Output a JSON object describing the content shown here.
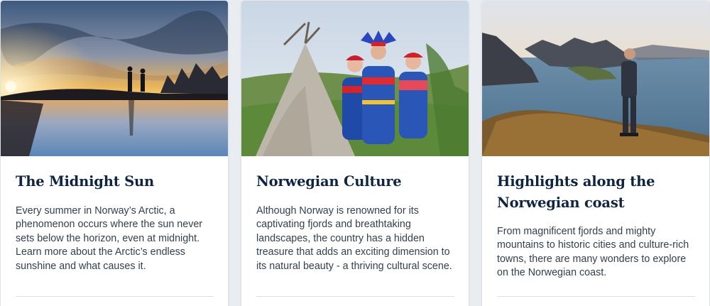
{
  "cards": [
    {
      "title": "The Midnight Sun",
      "body": "Every summer in Norway’s Arctic, a phenomenon occurs where the sun never sets below the horizon, even at midnight. Learn more about the Arctic’s endless sunshine and what causes it.",
      "image": "midnight-sun-photo"
    },
    {
      "title": "Norwegian Culture",
      "body": "Although Norway is renowned for its captivating fjords and breathtaking landscapes, the country has a hidden treasure that adds an exciting dimension to its natural beauty - a thriving cultural scene.",
      "image": "sami-culture-photo"
    },
    {
      "title": "Highlights along the Norwegian coast",
      "body": "From magnificent fjords and mighty mountains to historic cities and culture-rich towns, there are many wonders to explore on the Norwegian coast.",
      "image": "coastal-hiker-photo"
    }
  ],
  "colors": {
    "title": "#0f2543",
    "body": "#33404f",
    "background": "#e9edf2",
    "card": "#ffffff"
  }
}
